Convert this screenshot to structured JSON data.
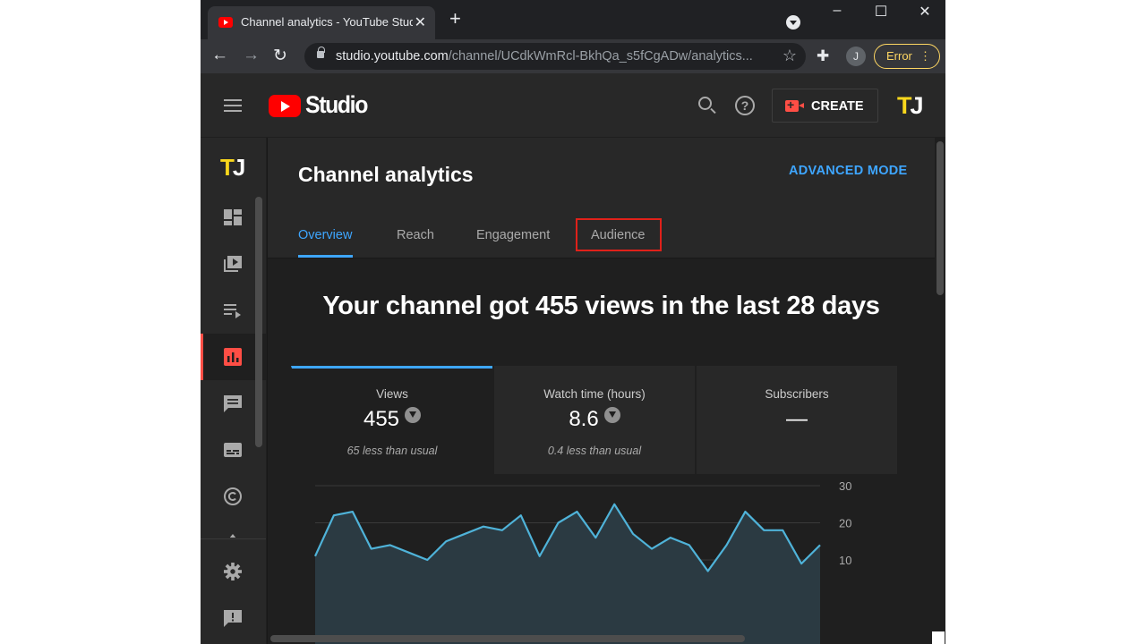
{
  "browser": {
    "tab_title": "Channel analytics - YouTube Studio",
    "tab_close": "✕",
    "new_tab": "+",
    "url_host": "studio.youtube.com",
    "url_path": "/channel/UCdkWmRcl-BkhQa_s5fCgADw/analytics...",
    "profile_initial": "J",
    "error_label": "Error",
    "window_controls": [
      "–",
      "☐",
      "✕"
    ]
  },
  "studio_header": {
    "logo_text": "Studio",
    "create_label": "CREATE",
    "channel_logo": "TJ"
  },
  "sidebar": {
    "channel_logo": "TJ",
    "items": [
      "dashboard",
      "content",
      "playlists",
      "analytics",
      "comments",
      "subtitles",
      "copyright",
      "settings",
      "feedback"
    ],
    "active": "analytics"
  },
  "page": {
    "title": "Channel analytics",
    "advanced_mode": "ADVANCED MODE",
    "tabs": [
      "Overview",
      "Reach",
      "Engagement",
      "Audience"
    ],
    "active_tab": "Overview",
    "highlighted_tab": "Audience",
    "headline": "Your channel got 455 views in the last 28 days"
  },
  "metrics": [
    {
      "label": "Views",
      "value": "455",
      "trend": "down",
      "note": "65 less than usual"
    },
    {
      "label": "Watch time (hours)",
      "value": "8.6",
      "trend": "down",
      "note": "0.4 less than usual"
    },
    {
      "label": "Subscribers",
      "value": "—",
      "trend": "",
      "note": ""
    }
  ],
  "chart_data": {
    "type": "area",
    "series": [
      {
        "values": [
          11,
          22,
          23,
          13,
          14,
          12,
          10,
          15,
          17,
          19,
          18,
          22,
          11,
          20,
          23,
          16,
          25,
          17,
          13,
          16,
          14,
          7,
          14,
          23,
          18,
          18,
          9,
          14
        ]
      }
    ],
    "y_ticks": [
      "30",
      "20",
      "10"
    ],
    "ylim": [
      0,
      30
    ],
    "grid": true,
    "colors": {
      "line": "#4fb3d9",
      "fill": "#2b3a42"
    }
  }
}
